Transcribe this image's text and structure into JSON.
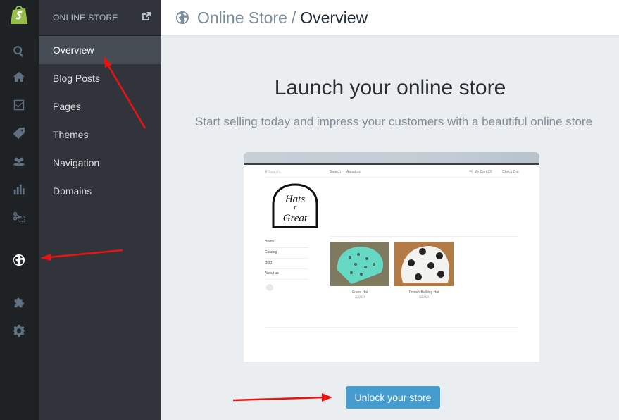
{
  "sidebar": {
    "icons": [
      {
        "name": "shopify-logo"
      },
      {
        "name": "search-icon"
      },
      {
        "name": "home-icon"
      },
      {
        "name": "orders-icon"
      },
      {
        "name": "tag-icon"
      },
      {
        "name": "customers-icon"
      },
      {
        "name": "reports-icon"
      },
      {
        "name": "discounts-icon"
      },
      {
        "name": "globe-icon",
        "active": true
      },
      {
        "name": "puzzle-icon"
      },
      {
        "name": "gear-icon"
      }
    ]
  },
  "subnav": {
    "title": "ONLINE STORE",
    "items": [
      {
        "label": "Overview",
        "active": true
      },
      {
        "label": "Blog Posts"
      },
      {
        "label": "Pages"
      },
      {
        "label": "Themes"
      },
      {
        "label": "Navigation"
      },
      {
        "label": "Domains"
      }
    ]
  },
  "header": {
    "breadcrumb_parent": "Online Store",
    "separator": "/",
    "breadcrumb_current": "Overview"
  },
  "main": {
    "title": "Launch your online store",
    "subtitle": "Start selling today and impress your customers with a beautiful online store",
    "cta_label": "Unlock your store"
  },
  "preview": {
    "search_placeholder": "Search",
    "nav_links": [
      "Search",
      "About us"
    ],
    "cart": "My Cart (0)",
    "checkout": "Check Out",
    "menu": [
      "Home",
      "Catalog",
      "Blog",
      "About us"
    ],
    "products": [
      {
        "name": "Crane Hat",
        "price": "$20.00"
      },
      {
        "name": "French Bulldog Hat",
        "price": "$20.00"
      }
    ]
  },
  "colors": {
    "accent": "#479ccf",
    "rail_bg": "#1f2225",
    "subnav_bg": "#31353b",
    "shopify_green": "#95bf47",
    "annotation": "#ee1111"
  }
}
